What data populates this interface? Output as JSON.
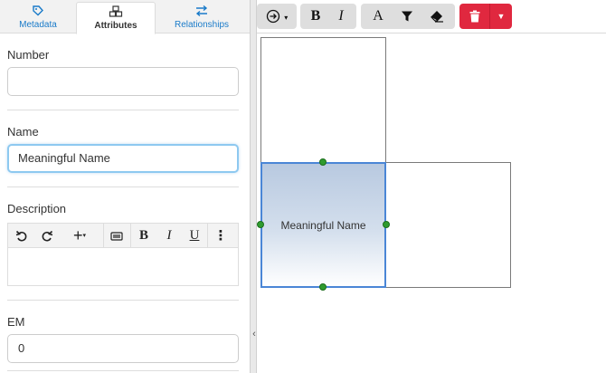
{
  "tabs": [
    {
      "label": "Metadata"
    },
    {
      "label": "Attributes"
    },
    {
      "label": "Relationships"
    }
  ],
  "fields": {
    "number": {
      "label": "Number",
      "value": ""
    },
    "name": {
      "label": "Name",
      "value": "Meaningful Name"
    },
    "description": {
      "label": "Description",
      "value": ""
    },
    "em": {
      "label": "EM",
      "value": "0"
    }
  },
  "diagram": {
    "selected_cell_label": "Meaningful Name"
  },
  "colors": {
    "accent": "#1a7bc9",
    "delete": "#e0283f",
    "selection": "#4a86d6",
    "handle": "#2e9b2e"
  }
}
